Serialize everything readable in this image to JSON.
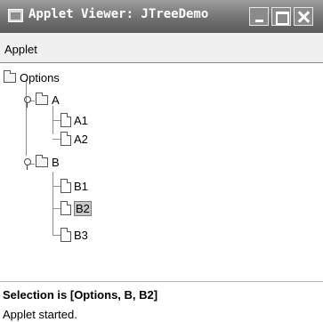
{
  "window": {
    "title": "Applet Viewer: JTreeDemo"
  },
  "menu": {
    "items": [
      "Applet"
    ]
  },
  "tree": {
    "root": "Options",
    "nodes": [
      "A",
      "A1",
      "A2",
      "B",
      "B1",
      "B2",
      "B3"
    ],
    "selected": "B2"
  },
  "selection_text": "Selection is [Options, B, B2]",
  "status": "Applet started.",
  "icons": [
    "app-icon",
    "minimize-icon",
    "maximize-icon",
    "close-icon",
    "folder-icon",
    "file-icon",
    "expand-handle-icon"
  ]
}
